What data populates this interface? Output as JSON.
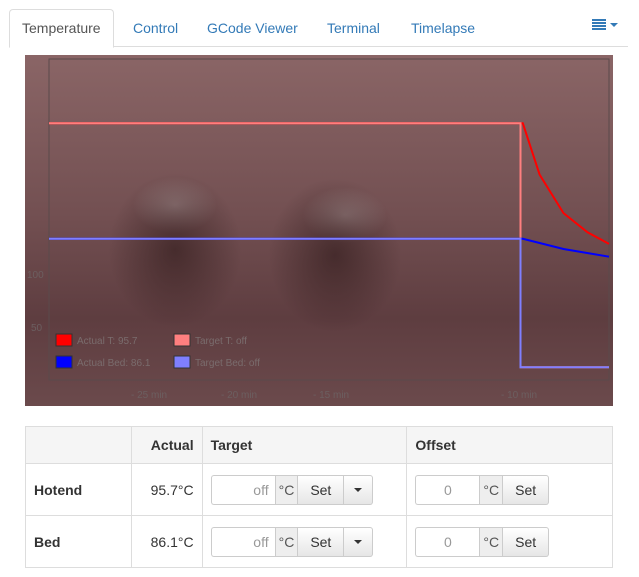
{
  "tabs": [
    {
      "label": "Temperature",
      "active": true
    },
    {
      "label": "Control",
      "active": false
    },
    {
      "label": "GCode Viewer",
      "active": false
    },
    {
      "label": "Terminal",
      "active": false
    },
    {
      "label": "Timelapse",
      "active": false
    }
  ],
  "graph": {
    "y_ticks": [
      "100",
      "50"
    ],
    "x_ticks": [
      "- 25 min",
      "- 20 min",
      "- 15 min",
      "- 10 min"
    ],
    "legend": [
      {
        "label": "Actual T: 95.7",
        "color": "#ff0000"
      },
      {
        "label": "Target T: off",
        "color": "#ff7f7f"
      },
      {
        "label": "Actual Bed: 86.1",
        "color": "#0000ff"
      },
      {
        "label": "Target Bed: off",
        "color": "#7f7fff"
      }
    ]
  },
  "chart_data": {
    "type": "line",
    "xlabel": "",
    "ylabel": "",
    "series": [
      {
        "name": "Actual T: 95.7",
        "color": "#ff0000",
        "points": [
          [
            -30,
            190
          ],
          [
            -10.2,
            190
          ],
          [
            -9.5,
            150
          ],
          [
            -8.5,
            120
          ],
          [
            -7.5,
            105
          ],
          [
            -6.6,
            96
          ]
        ]
      },
      {
        "name": "Target T: off",
        "color": "#ff7f7f",
        "points": [
          [
            -30,
            190
          ],
          [
            -10.3,
            190
          ],
          [
            -10.3,
            0
          ],
          [
            -6.6,
            0
          ]
        ]
      },
      {
        "name": "Actual Bed: 86.1",
        "color": "#0000ff",
        "points": [
          [
            -30,
            100
          ],
          [
            -10.2,
            100
          ],
          [
            -8.5,
            92
          ],
          [
            -6.6,
            86
          ]
        ]
      },
      {
        "name": "Target Bed: off",
        "color": "#7f7fff",
        "points": [
          [
            -30,
            100
          ],
          [
            -10.3,
            100
          ],
          [
            -10.3,
            0
          ],
          [
            -6.6,
            0
          ]
        ]
      }
    ]
  },
  "table": {
    "headers": {
      "name": "",
      "actual": "Actual",
      "target": "Target",
      "offset": "Offset"
    },
    "rows": [
      {
        "name": "Hotend",
        "actual": "95.7°C",
        "target_placeholder": "off",
        "offset_placeholder": "0"
      },
      {
        "name": "Bed",
        "actual": "86.1°C",
        "target_placeholder": "off",
        "offset_placeholder": "0"
      }
    ],
    "unit": "°C",
    "set_label": "Set"
  }
}
